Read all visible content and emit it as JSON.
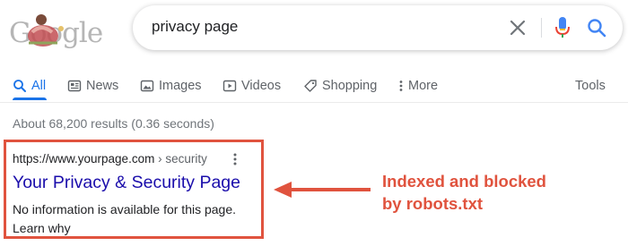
{
  "logo": {
    "text": "Google"
  },
  "search": {
    "query": "privacy page"
  },
  "tabs": [
    {
      "label": "All",
      "icon": "search-icon"
    },
    {
      "label": "News",
      "icon": "news-icon"
    },
    {
      "label": "Images",
      "icon": "image-icon"
    },
    {
      "label": "Videos",
      "icon": "video-icon"
    },
    {
      "label": "Shopping",
      "icon": "tag-icon"
    },
    {
      "label": "More",
      "icon": "more-vert-icon"
    }
  ],
  "tools_label": "Tools",
  "stats": "About 68,200 results (0.36 seconds)",
  "result": {
    "url": "https://www.yourpage.com",
    "breadcrumb": " › security",
    "title": "Your Privacy & Security Page",
    "snippet": "No information is available for this page.",
    "learn_why": "Learn why"
  },
  "annotation": {
    "line1": "Indexed and blocked",
    "line2": "by robots.txt"
  },
  "colors": {
    "accent_blue": "#1a73e8",
    "link_title": "#1a0dab",
    "annotation_red": "#e0533e"
  }
}
